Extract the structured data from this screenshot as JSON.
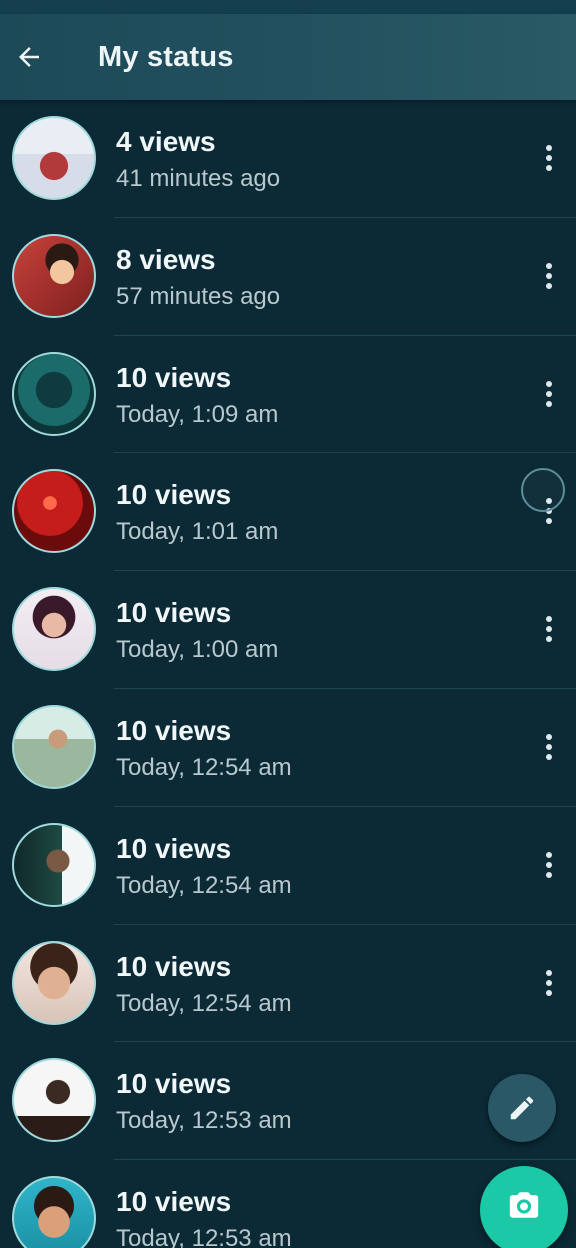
{
  "app_bar": {
    "title": "My status",
    "back_icon": "arrow-left-icon"
  },
  "status_list": [
    {
      "views": "4 views",
      "time": "41 minutes ago"
    },
    {
      "views": "8 views",
      "time": "57 minutes ago"
    },
    {
      "views": "10 views",
      "time": "Today, 1:09 am"
    },
    {
      "views": "10 views",
      "time": "Today, 1:01 am"
    },
    {
      "views": "10 views",
      "time": "Today, 1:00 am"
    },
    {
      "views": "10 views",
      "time": "Today, 12:54 am"
    },
    {
      "views": "10 views",
      "time": "Today, 12:54 am"
    },
    {
      "views": "10 views",
      "time": "Today, 12:54 am"
    },
    {
      "views": "10 views",
      "time": "Today, 12:53 am"
    },
    {
      "views": "10 views",
      "time": "Today, 12:53 am"
    }
  ],
  "fab": {
    "edit_icon": "pencil-icon",
    "camera_icon": "camera-icon",
    "camera_color": "#1bc9a6"
  },
  "theme": {
    "background": "#0b2a36",
    "app_bar": "#23505e",
    "accent": "#1bc9a6"
  }
}
